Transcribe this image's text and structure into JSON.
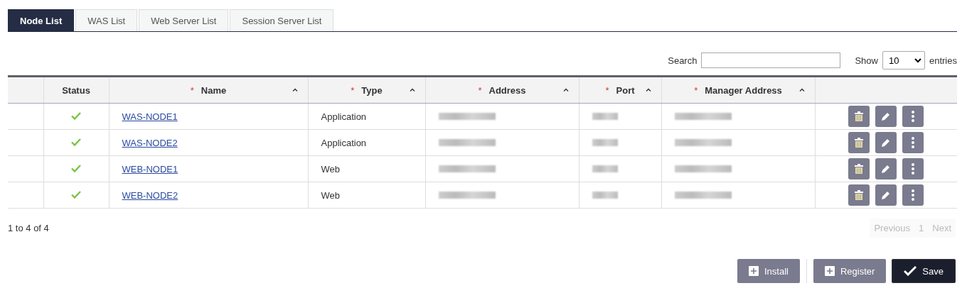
{
  "tabs": [
    {
      "label": "Node List",
      "selected": true
    },
    {
      "label": "WAS List",
      "selected": false
    },
    {
      "label": "Web Server List",
      "selected": false
    },
    {
      "label": "Session Server List",
      "selected": false
    }
  ],
  "search": {
    "label": "Search"
  },
  "length": {
    "prefix": "Show",
    "value": "10",
    "suffix": "entries"
  },
  "table": {
    "columns": [
      {
        "sortable": false
      },
      {
        "label": "Status",
        "sortable": false
      },
      {
        "label": "Name",
        "required_mark": "*",
        "sortable": true
      },
      {
        "label": "Type",
        "required_mark": "*",
        "sortable": true
      },
      {
        "label": "Address",
        "required_mark": "*",
        "sortable": true
      },
      {
        "label": "Port",
        "required_mark": "*",
        "sortable": true
      },
      {
        "label": "Manager Address",
        "required_mark": "*",
        "sortable": true
      },
      {
        "sortable": false
      }
    ],
    "rows": [
      {
        "kind": "ok",
        "name": "WAS-NODE1",
        "type": "Application"
      },
      {
        "kind": "ok",
        "name": "WAS-NODE2",
        "type": "Application"
      },
      {
        "kind": "ok",
        "name": "WEB-NODE1",
        "type": "Web"
      },
      {
        "kind": "ok",
        "name": "WEB-NODE2",
        "type": "Web"
      }
    ]
  },
  "info": "1 to 4 of 4",
  "pager": [
    {
      "label": "Previous",
      "disabled": true
    },
    {
      "label": "1",
      "disabled": true
    },
    {
      "label": "Next",
      "disabled": true
    }
  ],
  "buttons": [
    {
      "label": "Install",
      "kind": "add"
    },
    {
      "label": "Register",
      "kind": "add"
    },
    {
      "label": "Save",
      "kind": "save"
    }
  ]
}
